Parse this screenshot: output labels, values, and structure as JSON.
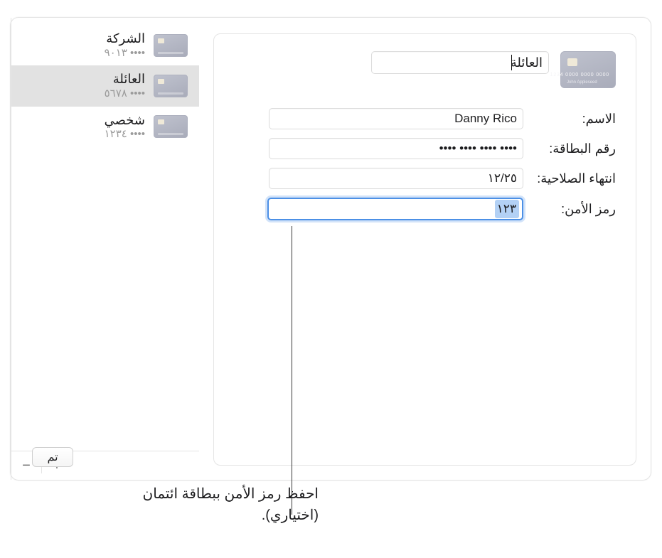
{
  "sidebar": {
    "items": [
      {
        "name": "الشركة",
        "mask": "٩٠١٣ ••••"
      },
      {
        "name": "العائلة",
        "mask": "٥٦٧٨ ••••"
      },
      {
        "name": "شخصي",
        "mask": "١٢٣٤ ••••"
      }
    ],
    "selected_index": 1,
    "add_label": "+",
    "remove_label": "−"
  },
  "detail": {
    "title_value": "العائلة",
    "card_preview_number": "0000 0000 0000 1234",
    "card_preview_name": "John Appleseed",
    "fields": {
      "name": {
        "label": "الاسم:",
        "value": "Danny Rico"
      },
      "number": {
        "label": "رقم البطاقة:",
        "value": "•••• •••• •••• ••••"
      },
      "expiry": {
        "label": "انتهاء الصلاحية:",
        "value": "١٢/٢٥"
      },
      "security": {
        "label": "رمز الأمن:",
        "value": "١٢٣"
      }
    }
  },
  "footer": {
    "done_label": "تم"
  },
  "callout": {
    "text": "احفظ رمز الأمن ببطاقة ائتمان (اختياري)."
  }
}
